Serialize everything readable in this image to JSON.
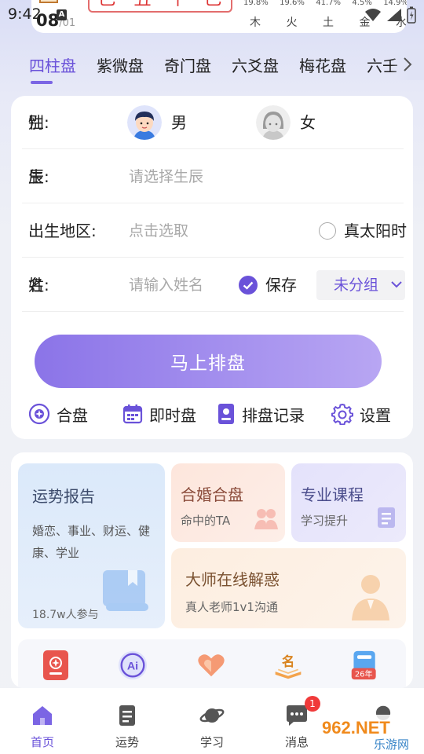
{
  "status_bar": {
    "time": "9:42",
    "notif_letter": "A",
    "day_big": "08",
    "day_small": "/01",
    "ganzhi": [
      "巳",
      "丑",
      "午",
      "巳"
    ],
    "element_percents": [
      "19.8%",
      "19.6%",
      "41.7%",
      "4.5%",
      "14.9%"
    ],
    "elements": [
      "木",
      "火",
      "土",
      "金",
      "水"
    ]
  },
  "tabs": {
    "items": [
      "四柱盘",
      "紫微盘",
      "奇门盘",
      "六爻盘",
      "梅花盘",
      "六壬"
    ],
    "active_index": 0
  },
  "form": {
    "gender": {
      "label_a": "性",
      "label_b": "别:",
      "male": "男",
      "female": "女"
    },
    "birth": {
      "label_a": "生",
      "label_b": "辰:",
      "placeholder": "请选择生辰"
    },
    "location": {
      "label": "出生地区:",
      "placeholder": "点击选取",
      "true_solar": "真太阳时"
    },
    "name": {
      "label_a": "姓",
      "label_b": "名:",
      "placeholder": "请输入姓名",
      "save": "保存",
      "group": "未分组"
    },
    "submit": "马上排盘",
    "actions": [
      "合盘",
      "即时盘",
      "排盘记录",
      "设置"
    ]
  },
  "features": {
    "fortune_report": {
      "title": "运势报告",
      "desc": "婚恋、事业、财运、健康、学业",
      "count": "18.7w人参与"
    },
    "marriage": {
      "title": "合婚合盘",
      "sub": "命中的TA"
    },
    "course": {
      "title": "专业课程",
      "sub": "学习提升"
    },
    "master": {
      "title": "大师在线解惑",
      "sub": "真人老师1v1沟通"
    },
    "shortcut_badge": "26年",
    "shortcut_name_glyph": "名",
    "ai_label": "Ai"
  },
  "bottom_nav": {
    "items": [
      "首页",
      "运势",
      "学习",
      "消息"
    ],
    "active_index": 0,
    "message_badge": "1"
  },
  "watermark": {
    "text_top": "962.NET",
    "text_bottom": "乐游网"
  },
  "colors": {
    "accent": "#6a52d9",
    "badge": "#f03a3a",
    "ganzhi_red": "#d33333"
  }
}
